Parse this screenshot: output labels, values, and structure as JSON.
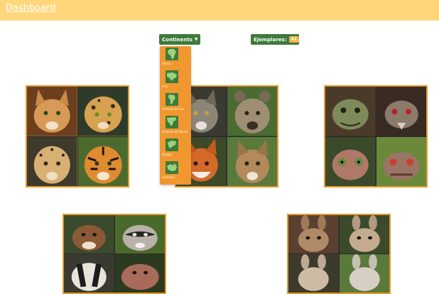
{
  "header": {
    "title": "Dashboard"
  },
  "toolbar": {
    "continents_label": "Continents",
    "ejemplares_label": "Ejemplares:",
    "ejemplares_count": "41"
  },
  "continents_menu": [
    {
      "label": "Africa",
      "icon": "africa-map-icon"
    },
    {
      "label": "Asia",
      "icon": "asia-map-icon"
    },
    {
      "label": "America del Sur",
      "icon": "south-america-map-icon"
    },
    {
      "label": "America del Norte",
      "icon": "north-america-map-icon"
    },
    {
      "label": "Europa",
      "icon": "europe-map-icon"
    },
    {
      "label": "Australia",
      "icon": "australia-map-icon"
    }
  ],
  "colors": {
    "topbar": "#ffd77a",
    "button": "#3f7a3a",
    "menu": "#f0982f",
    "card_border": "#e39a2b"
  },
  "animal_grids": [
    {
      "name": "big-cats",
      "animals": [
        "lynx-icon",
        "leopard-icon",
        "cheetah-icon",
        "tiger-icon"
      ]
    },
    {
      "name": "canines",
      "animals": [
        "wolf-icon",
        "hyena-icon",
        "fox-icon",
        "coyote-icon"
      ]
    },
    {
      "name": "reptiles",
      "animals": [
        "turtle-icon",
        "snake-icon",
        "chameleon-icon",
        "iguana-icon"
      ]
    },
    {
      "name": "mustelids",
      "animals": [
        "weasel-icon",
        "raccoon-icon",
        "badger-icon",
        "hippo-icon"
      ]
    },
    {
      "name": "rabbits",
      "animals": [
        "rabbit-icon",
        "hare-icon",
        "bunny-icon",
        "jackrabbit-icon"
      ]
    }
  ]
}
